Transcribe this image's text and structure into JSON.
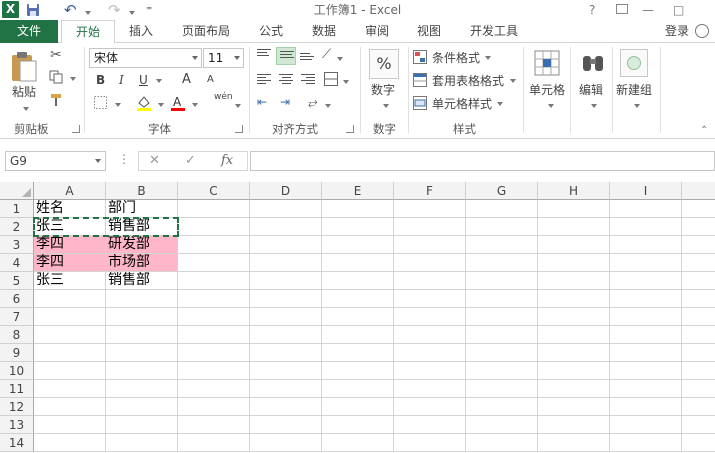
{
  "window": {
    "title": "工作簿1 - Excel",
    "app_icon": "X",
    "help": "?",
    "minimize": "—",
    "restore": "□"
  },
  "qat": {
    "save_icon": "save-icon",
    "undo_glyph": "↶",
    "redo_glyph": "↷",
    "customize_glyph": "⁼"
  },
  "tabs": {
    "file": "文件",
    "items": [
      "开始",
      "插入",
      "页面布局",
      "公式",
      "数据",
      "审阅",
      "视图",
      "开发工具"
    ],
    "active": "开始",
    "login": "登录"
  },
  "ribbon": {
    "clipboard": {
      "label": "剪贴板",
      "paste": "粘贴"
    },
    "font": {
      "label": "字体",
      "name": "宋体",
      "size": "11",
      "bold": "B",
      "italic": "I",
      "underline": "U",
      "grow": "A",
      "shrink": "A",
      "phonetic": "wén"
    },
    "alignment": {
      "label": "对齐方式"
    },
    "number": {
      "label": "数字",
      "percent": "%"
    },
    "styles": {
      "label": "样式",
      "conditional": "条件格式",
      "table": "套用表格格式",
      "cell_styles": "单元格样式"
    },
    "cells": {
      "label": "单元格"
    },
    "editing": {
      "label": "编辑"
    },
    "newgroup": {
      "label": "新建组"
    }
  },
  "formula_bar": {
    "name_box": "G9",
    "dots": "⋮",
    "cancel": "✕",
    "enter": "✓",
    "fx": "fx",
    "content": ""
  },
  "sheet": {
    "columns": [
      "A",
      "B",
      "C",
      "D",
      "E",
      "F",
      "G",
      "H",
      "I"
    ],
    "rows": [
      "1",
      "2",
      "3",
      "4",
      "5",
      "6",
      "7",
      "8",
      "9",
      "10",
      "11",
      "12",
      "13",
      "14"
    ],
    "cells": {
      "A1": "姓名",
      "B1": "部门",
      "A2": "张三",
      "B2": "销售部",
      "A3": "李四",
      "B3": "研发部",
      "A4": "李四",
      "B4": "市场部",
      "A5": "张三",
      "B5": "销售部"
    },
    "highlight_color": "#ffb6c8",
    "marquee_color": "#217346"
  }
}
